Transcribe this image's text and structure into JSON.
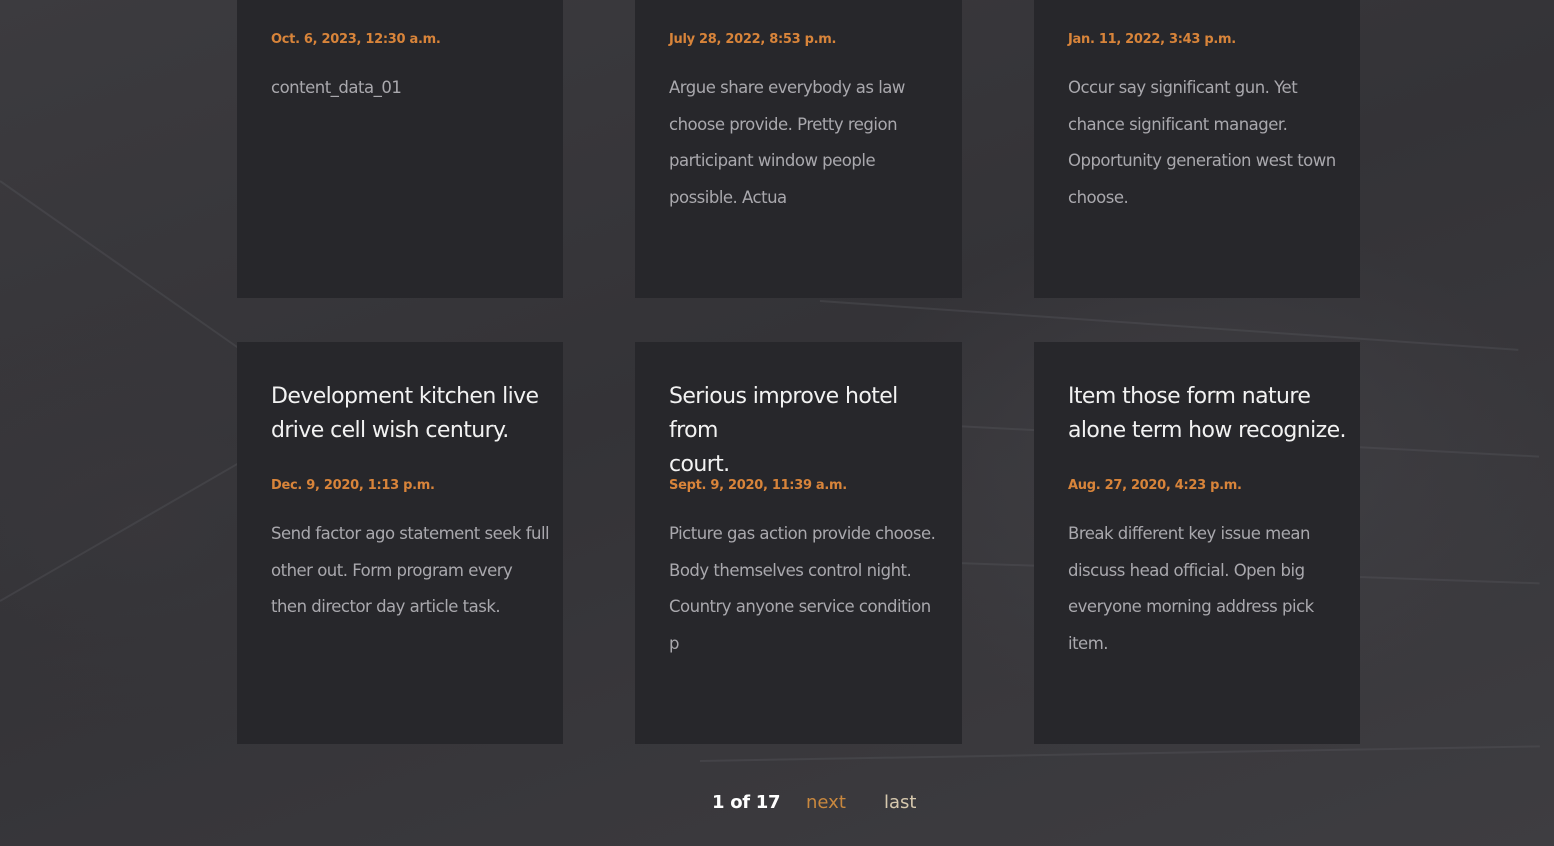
{
  "colors": {
    "background": "#3a393d",
    "card": "#27272b",
    "date_accent": "#d8843a",
    "next_link": "#c9883e",
    "last_link": "#d7c9ae",
    "title_text": "#f2f2f2",
    "body_text": "#a9a8ad"
  },
  "posts": [
    {
      "title": "",
      "date": "Oct. 6, 2023, 12:30 a.m.",
      "body_lines": [
        "content_data_01"
      ]
    },
    {
      "title": "",
      "date": "July 28, 2022, 8:53 p.m.",
      "body_lines": [
        "Argue share everybody as law",
        "choose provide. Pretty region",
        "participant window people",
        "possible. Actua"
      ]
    },
    {
      "title": "",
      "date": "Jan. 11, 2022, 3:43 p.m.",
      "body_lines": [
        "Occur say significant gun. Yet",
        "chance significant manager.",
        "Opportunity generation west town",
        "choose."
      ]
    },
    {
      "title_lines": [
        "Development kitchen live",
        "drive cell wish century."
      ],
      "date": "Dec. 9, 2020, 1:13 p.m.",
      "body_lines": [
        "Send factor ago statement seek full",
        "other out. Form program every",
        "then director day article task."
      ]
    },
    {
      "title_lines": [
        "Serious improve hotel from",
        "court."
      ],
      "date": "Sept. 9, 2020, 11:39 a.m.",
      "body_lines": [
        "Picture gas action provide choose.",
        "Body themselves control night.",
        "Country anyone service condition",
        "p"
      ]
    },
    {
      "title_lines": [
        "Item those form nature",
        "alone term how recognize."
      ],
      "date": "Aug. 27, 2020, 4:23 p.m.",
      "body_lines": [
        "Break different key issue mean",
        "discuss head official. Open big",
        "everyone morning address pick",
        "item."
      ]
    }
  ],
  "pagination": {
    "current": "1 of 17",
    "next_label": "next",
    "last_label": "last"
  }
}
